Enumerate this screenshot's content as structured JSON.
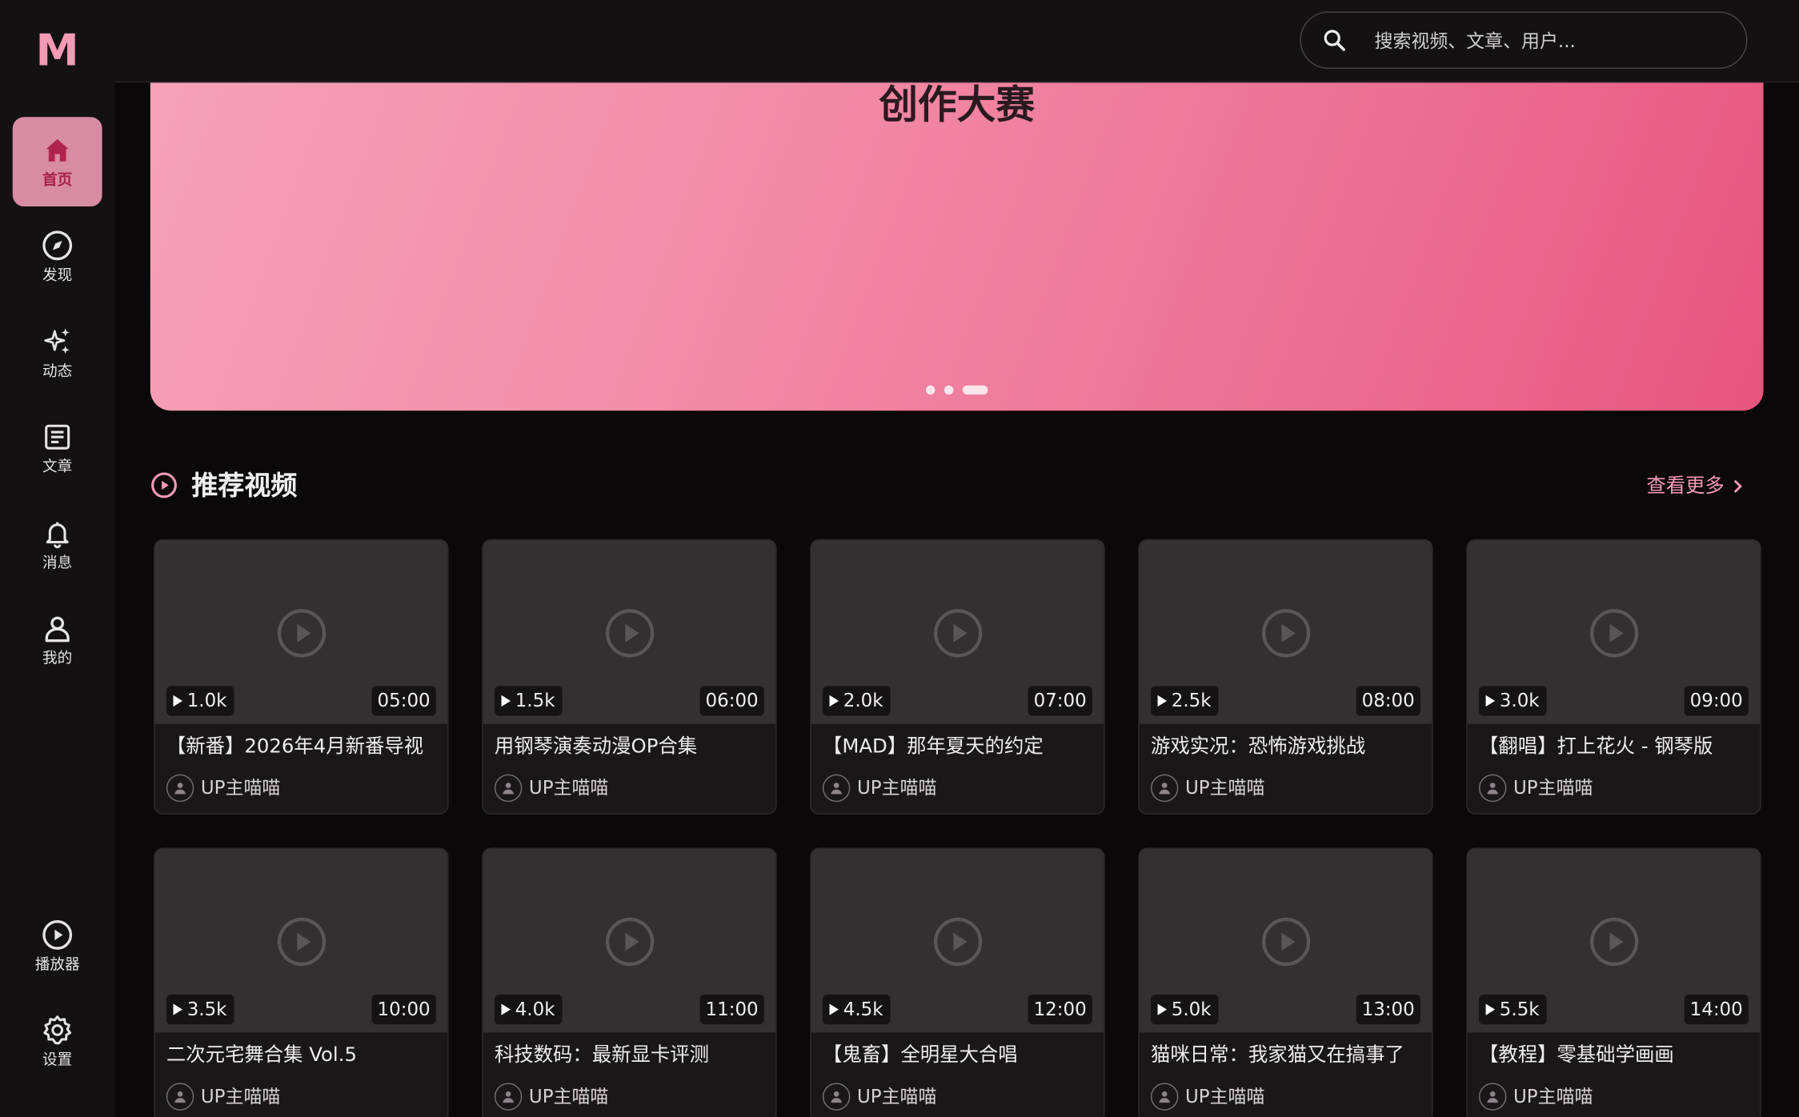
{
  "app": {
    "logo": "M"
  },
  "sidebar": {
    "items": [
      {
        "label": "首页",
        "icon": "home-icon",
        "active": true
      },
      {
        "label": "发现",
        "icon": "compass-icon"
      },
      {
        "label": "动态",
        "icon": "sparkles-icon"
      },
      {
        "label": "文章",
        "icon": "article-icon"
      },
      {
        "label": "消息",
        "icon": "bell-icon"
      },
      {
        "label": "我的",
        "icon": "user-icon"
      }
    ],
    "bottom": [
      {
        "label": "播放器",
        "icon": "play-circle-icon"
      },
      {
        "label": "设置",
        "icon": "gear-icon"
      }
    ]
  },
  "search": {
    "placeholder": "搜索视频、文章、用户..."
  },
  "banner": {
    "title": "创作大赛",
    "slides": 3,
    "active_slide": 3
  },
  "section": {
    "title": "推荐视频",
    "more": "查看更多"
  },
  "videos": [
    {
      "views": "1.0k",
      "duration": "05:00",
      "title": "【新番】2026年4月新番导视",
      "author": "UP主喵喵"
    },
    {
      "views": "1.5k",
      "duration": "06:00",
      "title": "用钢琴演奏动漫OP合集",
      "author": "UP主喵喵"
    },
    {
      "views": "2.0k",
      "duration": "07:00",
      "title": "【MAD】那年夏天的约定",
      "author": "UP主喵喵"
    },
    {
      "views": "2.5k",
      "duration": "08:00",
      "title": "游戏实况：恐怖游戏挑战",
      "author": "UP主喵喵"
    },
    {
      "views": "3.0k",
      "duration": "09:00",
      "title": "【翻唱】打上花火 - 钢琴版",
      "author": "UP主喵喵"
    },
    {
      "views": "3.5k",
      "duration": "10:00",
      "title": "二次元宅舞合集 Vol.5",
      "author": "UP主喵喵"
    },
    {
      "views": "4.0k",
      "duration": "11:00",
      "title": "科技数码：最新显卡评测",
      "author": "UP主喵喵"
    },
    {
      "views": "4.5k",
      "duration": "12:00",
      "title": "【鬼畜】全明星大合唱",
      "author": "UP主喵喵"
    },
    {
      "views": "5.0k",
      "duration": "13:00",
      "title": "猫咪日常：我家猫又在搞事了",
      "author": "UP主喵喵"
    },
    {
      "views": "5.5k",
      "duration": "14:00",
      "title": "【教程】零基础学画画",
      "author": "UP主喵喵"
    }
  ],
  "colors": {
    "accent": "#f39ab5",
    "active_nav_bg": "#d88ca4",
    "banner_start": "#f5a3b9",
    "banner_end": "#e8557f"
  }
}
